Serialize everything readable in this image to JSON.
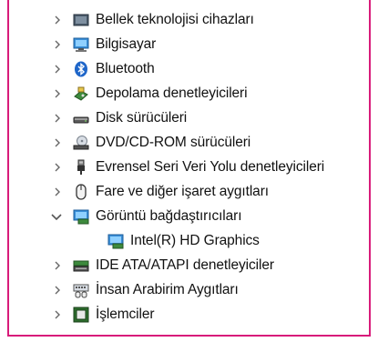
{
  "device_tree": {
    "items": [
      {
        "label": "Bellek teknolojisi cihazları",
        "state": "collapsed",
        "icon": "memory-tech-icon"
      },
      {
        "label": "Bilgisayar",
        "state": "collapsed",
        "icon": "computer-icon"
      },
      {
        "label": "Bluetooth",
        "state": "collapsed",
        "icon": "bluetooth-icon"
      },
      {
        "label": "Depolama denetleyicileri",
        "state": "collapsed",
        "icon": "storage-controller-icon"
      },
      {
        "label": "Disk sürücüleri",
        "state": "collapsed",
        "icon": "disk-drive-icon"
      },
      {
        "label": "DVD/CD-ROM sürücüleri",
        "state": "collapsed",
        "icon": "dvd-drive-icon"
      },
      {
        "label": "Evrensel Seri Veri Yolu denetleyicileri",
        "state": "collapsed",
        "icon": "usb-icon"
      },
      {
        "label": "Fare ve diğer işaret aygıtları",
        "state": "collapsed",
        "icon": "mouse-icon"
      },
      {
        "label": "Görüntü bağdaştırıcıları",
        "state": "expanded",
        "icon": "display-adapter-icon"
      },
      {
        "label": "Intel(R) HD Graphics",
        "state": "child",
        "icon": "display-adapter-icon"
      },
      {
        "label": "IDE ATA/ATAPI denetleyiciler",
        "state": "collapsed",
        "icon": "ide-controller-icon"
      },
      {
        "label": "İnsan Arabirim Aygıtları",
        "state": "collapsed",
        "icon": "hid-icon"
      },
      {
        "label": "İşlemciler",
        "state": "collapsed",
        "icon": "processor-icon"
      }
    ]
  },
  "colors": {
    "frame_border": "#d81b7a",
    "chevron": "#666666",
    "text": "#111111"
  }
}
